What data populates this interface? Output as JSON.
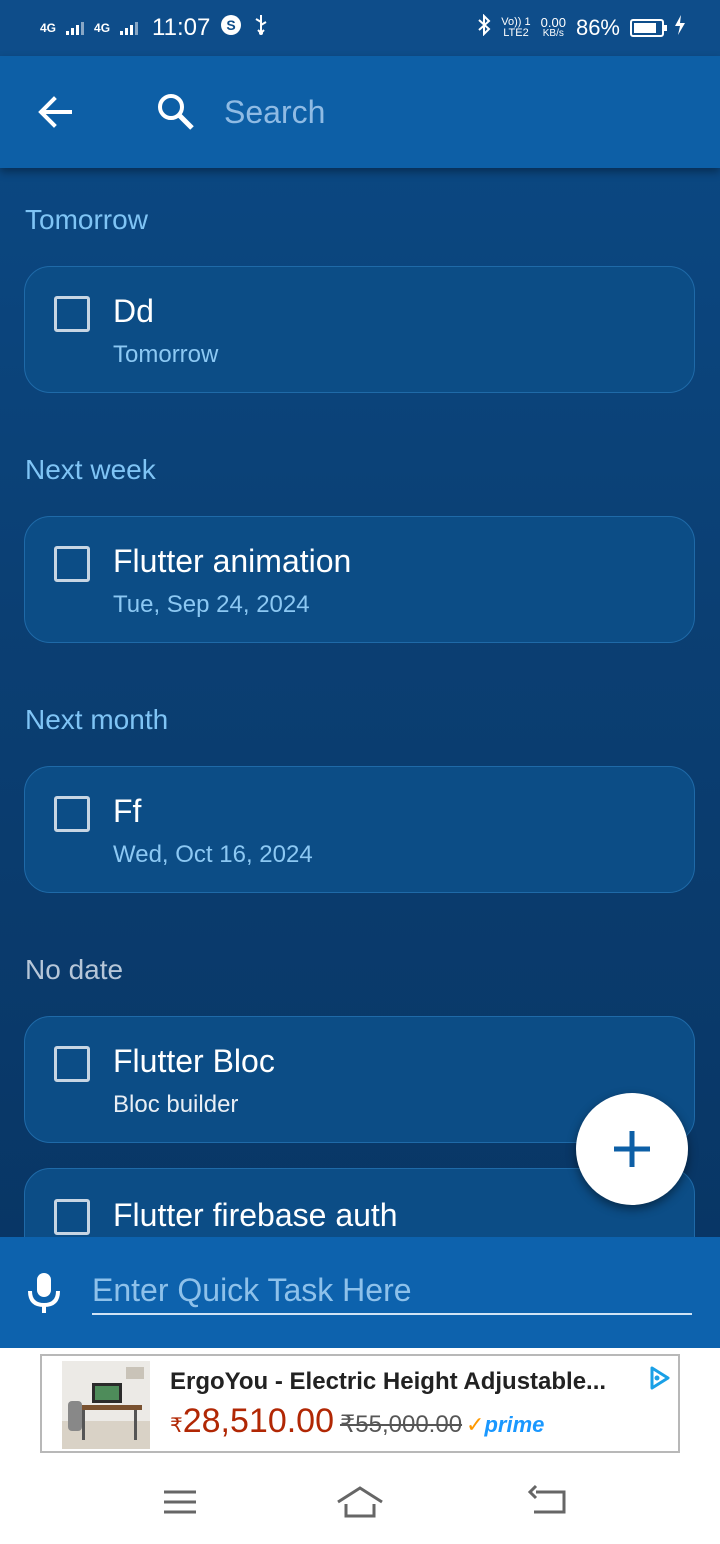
{
  "status_bar": {
    "network_1": "4G",
    "network_2": "4G",
    "time": "11:07",
    "speed_value": "0.00",
    "speed_unit": "KB/s",
    "volte": "Vo)) 1",
    "lte": "LTE2",
    "battery": "86%"
  },
  "app_bar": {
    "search_placeholder": "Search"
  },
  "sections": [
    {
      "heading": "Tomorrow",
      "tasks": [
        {
          "title": "Dd",
          "subtitle": "Tomorrow"
        }
      ]
    },
    {
      "heading": "Next week",
      "tasks": [
        {
          "title": "Flutter animation",
          "subtitle": "Tue, Sep 24, 2024"
        }
      ]
    },
    {
      "heading": "Next month",
      "tasks": [
        {
          "title": "Ff",
          "subtitle": "Wed, Oct 16, 2024"
        }
      ]
    },
    {
      "heading": "No date",
      "tasks": [
        {
          "title": "Flutter Bloc",
          "subtitle": "Bloc builder"
        },
        {
          "title": "Flutter firebase auth",
          "subtitle": ""
        }
      ]
    }
  ],
  "quick_task": {
    "placeholder": "Enter Quick Task Here"
  },
  "ad": {
    "title": "ErgoYou - Electric Height Adjustable...",
    "currency": "₹",
    "price": "28,510.00",
    "old_price": "₹55,000.00",
    "prime_check": "✓",
    "prime": "prime"
  },
  "colors": {
    "app_bar": "#0d5fa6",
    "background": "#0b4175",
    "card": "#0c4d86",
    "heading_accent": "#7fc4f5",
    "fab_icon": "#0d5fa6"
  },
  "icons": {
    "back": "arrow-back-icon",
    "search": "search-icon",
    "add": "plus-icon",
    "mic": "mic-icon",
    "nav_menu": "menu-icon",
    "nav_home": "home-icon",
    "nav_back": "back-nav-icon"
  }
}
